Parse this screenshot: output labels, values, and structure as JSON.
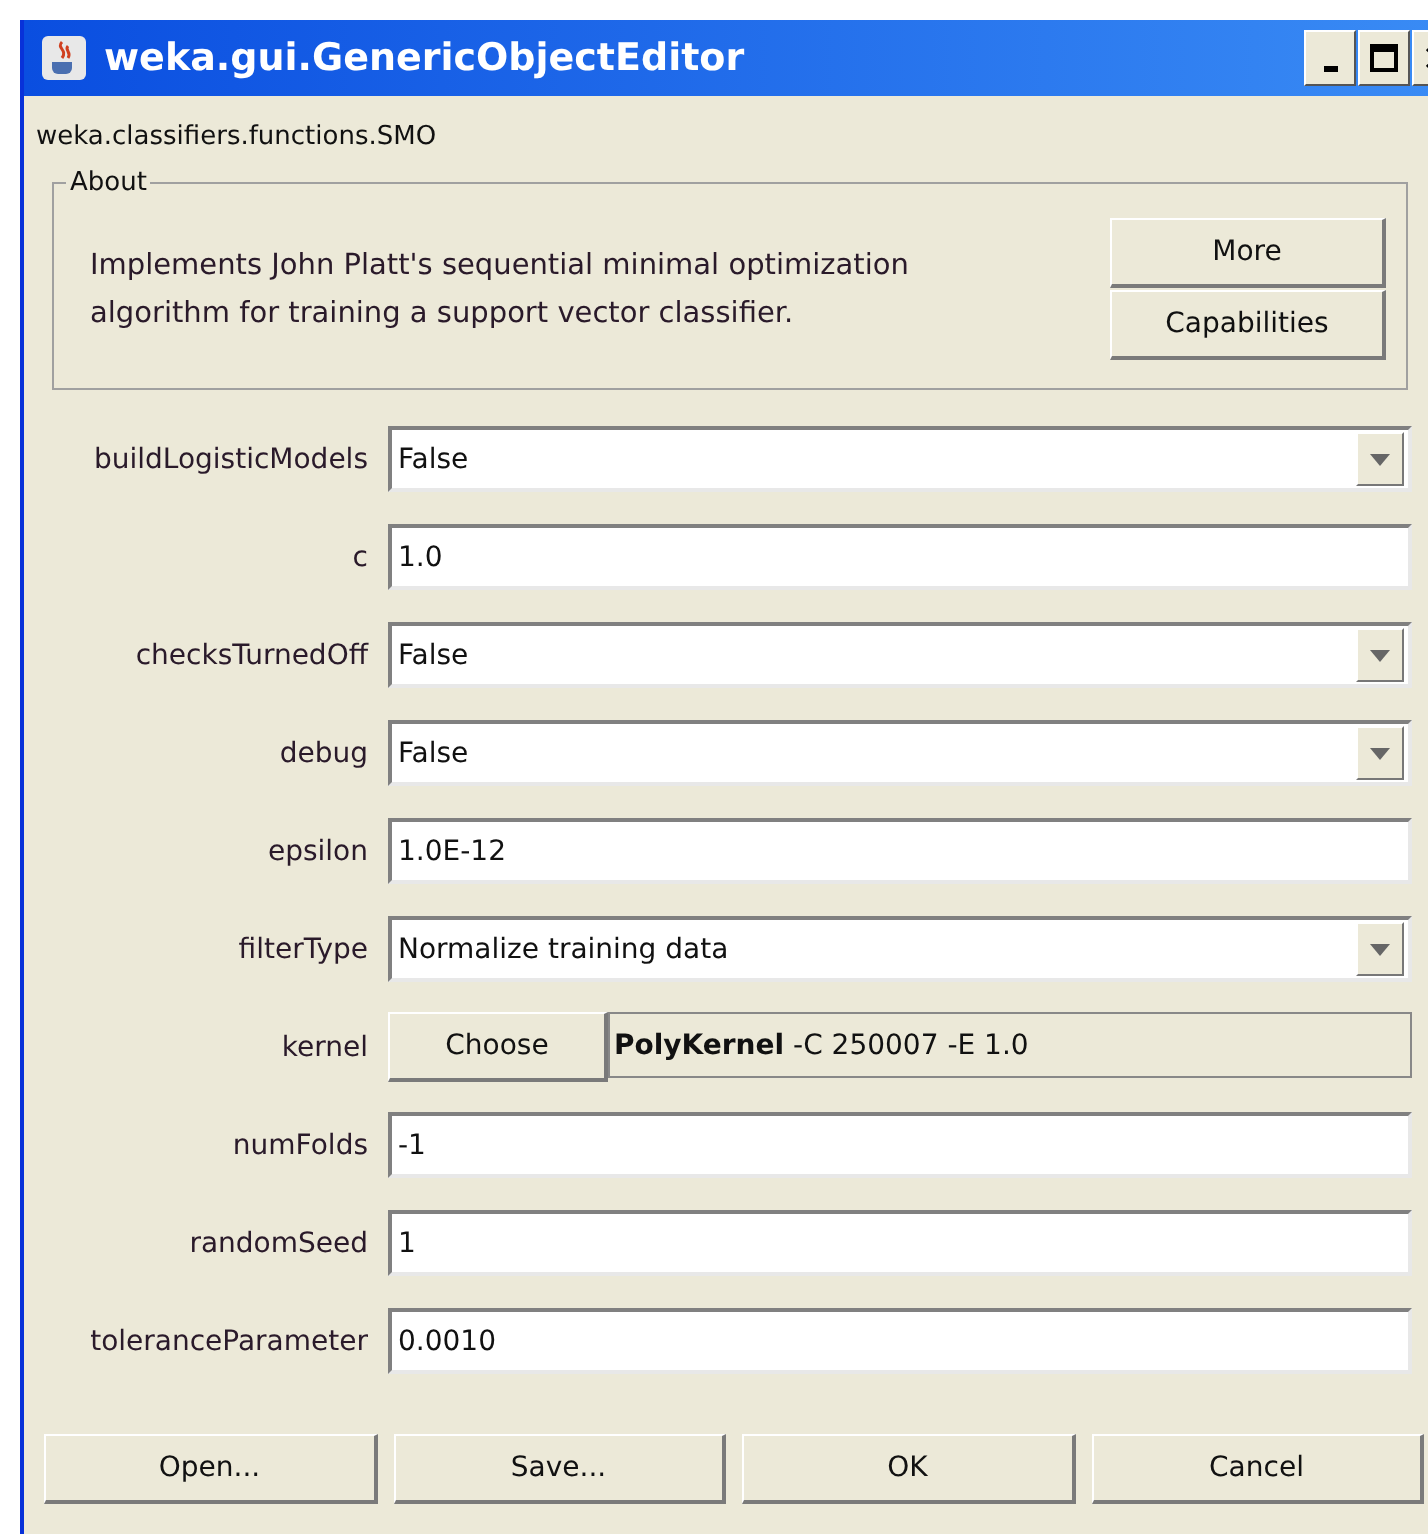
{
  "window": {
    "title": "weka.gui.GenericObjectEditor"
  },
  "class_name": "weka.classifiers.functions.SMO",
  "about": {
    "title": "About",
    "text": "Implements John Platt's sequential minimal optimization algorithm for training a support vector classifier.",
    "buttons": [
      "More",
      "Capabilities"
    ]
  },
  "properties": [
    {
      "kind": "dropdown",
      "label": "buildLogisticModels",
      "value": "False"
    },
    {
      "kind": "text",
      "label": "c",
      "value": "1.0"
    },
    {
      "kind": "dropdown",
      "label": "checksTurnedOff",
      "value": "False"
    },
    {
      "kind": "dropdown",
      "label": "debug",
      "value": "False"
    },
    {
      "kind": "text",
      "label": "epsilon",
      "value": "1.0E-12"
    },
    {
      "kind": "dropdown",
      "label": "filterType",
      "value": "Normalize training data"
    },
    {
      "kind": "chooser",
      "label": "kernel",
      "button": "Choose",
      "value": "**PolyKernel** -C 250007 -E 1.0"
    },
    {
      "kind": "text",
      "label": "numFolds",
      "value": "-1"
    },
    {
      "kind": "text",
      "label": "randomSeed",
      "value": "1"
    },
    {
      "kind": "text",
      "label": "toleranceParameter",
      "value": "0.0010"
    }
  ],
  "buttons": [
    "Open...",
    "Save...",
    "OK",
    "Cancel"
  ]
}
